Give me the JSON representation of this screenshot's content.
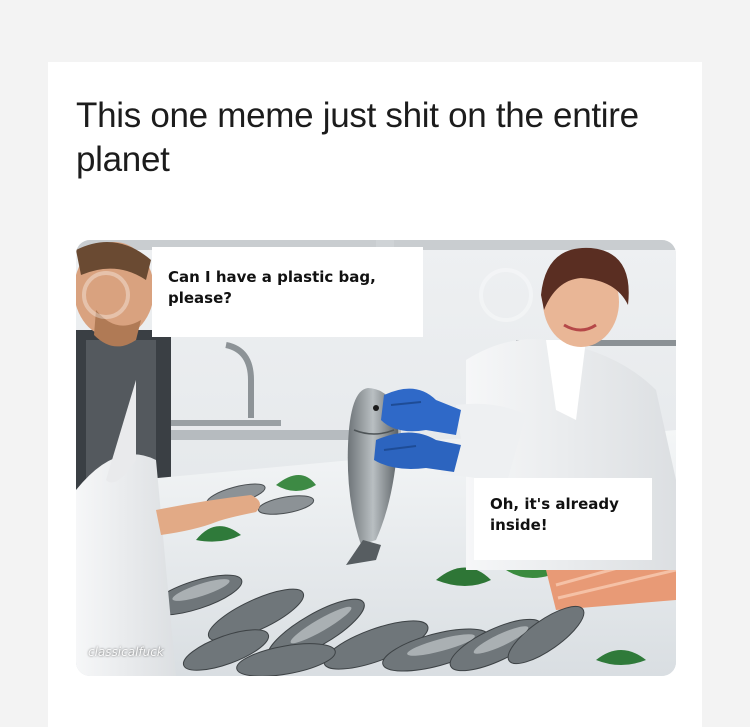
{
  "post": {
    "text_line1": "This one meme just shit on the entire",
    "text_line2": "planet"
  },
  "meme": {
    "customer_caption_line1": "Can I have a plastic bag,",
    "customer_caption_line2": "please?",
    "vendor_caption_line1": "Oh, it's already",
    "vendor_caption_line2": "inside!",
    "watermark": "classicalfuck"
  }
}
